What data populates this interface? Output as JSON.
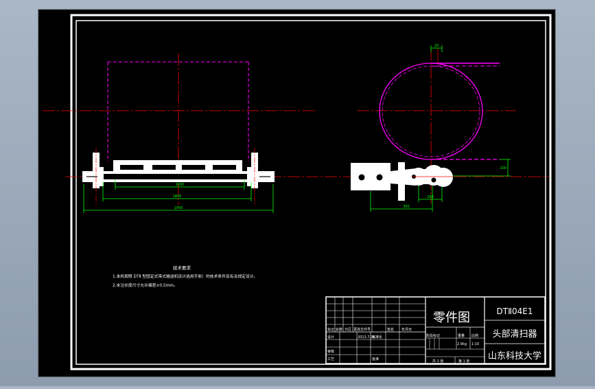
{
  "colors": {
    "background_gradient": [
      "#a9b7c6",
      "#8d9cae"
    ],
    "canvas": "#000000",
    "frame": "#ffffff",
    "centerline": "#ff0000",
    "hidden_outline": "#ff00ff",
    "dimension": "#00ff00",
    "annotation_text": "#ffffff"
  },
  "drawing": {
    "dimensions": {
      "inner_span": "1600",
      "mid_span": "1800",
      "outer_span": "1950",
      "offset_small": "20",
      "arm_length": "300",
      "arm_offset": "280",
      "vertical_offset": "100"
    },
    "notes": {
      "title": "技术要求",
      "line1": "1.本机按照 DTⅡ 型固定式带式输送机设计选用手册）的技术条件及有关规定设计。",
      "line2": "2.未注长度尺寸允许偏差±0.5mm。"
    }
  },
  "title_block": {
    "drawing_kind": "零件图",
    "drawing_code": "DTⅡ04E1",
    "part_name": "头部清扫器",
    "organization": "山东科技大学",
    "rev_headers": [
      "标记",
      "处数",
      "分区",
      "更改文件号",
      "签名",
      "年月日"
    ],
    "role_design": "设计",
    "role_design_date": "2013.7.26",
    "role_standard": "标准化",
    "role_check": "审核",
    "role_process": "工艺",
    "role_approve": "批准",
    "stage_headers": [
      "阶段标记",
      "重量",
      "比例"
    ],
    "weight": "2.9kg",
    "scale": "1:10",
    "sheets_total": "共 1 张",
    "sheet_number": "第 1 张"
  }
}
